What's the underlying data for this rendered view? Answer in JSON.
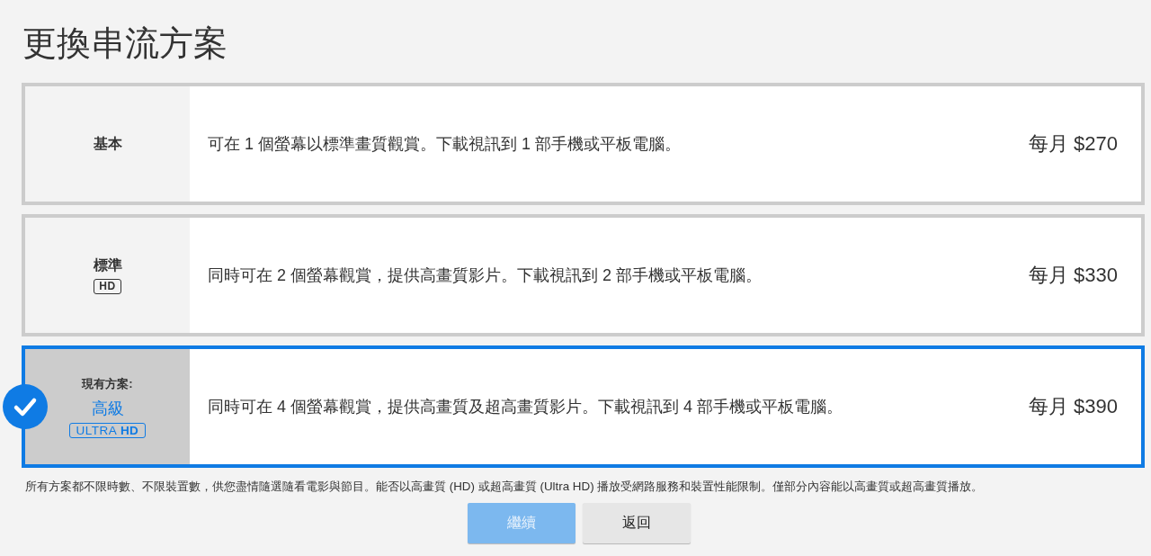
{
  "page": {
    "title": "更換串流方案"
  },
  "plans": [
    {
      "name": "基本",
      "description": "可在 1 個螢幕以標準畫質觀賞。下載視訊到 1 部手機或平板電腦。",
      "price": "每月 $270",
      "selected": false
    },
    {
      "name": "標準",
      "badge": {
        "kind": "hd",
        "text": "HD"
      },
      "description": "同時可在 2 個螢幕觀賞，提供高畫質影片。下載視訊到 2 部手機或平板電腦。",
      "price": "每月 $330",
      "selected": false
    },
    {
      "current_label": "現有方案:",
      "name": "高級",
      "badge": {
        "kind": "ultra",
        "text": "ULTRA **HD**"
      },
      "description": "同時可在 4 個螢幕觀賞，提供高畫質及超高畫質影片。下載視訊到 4 部手機或平板電腦。",
      "price": "每月 $390",
      "selected": true
    }
  ],
  "footnote": "所有方案都不限時數、不限裝置數，供您盡情隨選隨看電影與節目。能否以高畫質 (HD) 或超高畫質 (Ultra HD) 播放受網路服務和裝置性能限制。僅部分內容能以高畫質或超高畫質播放。",
  "buttons": [
    {
      "label": "繼續",
      "kind": "primary",
      "disabled": true
    },
    {
      "label": "返回",
      "kind": "secondary",
      "disabled": false
    }
  ]
}
